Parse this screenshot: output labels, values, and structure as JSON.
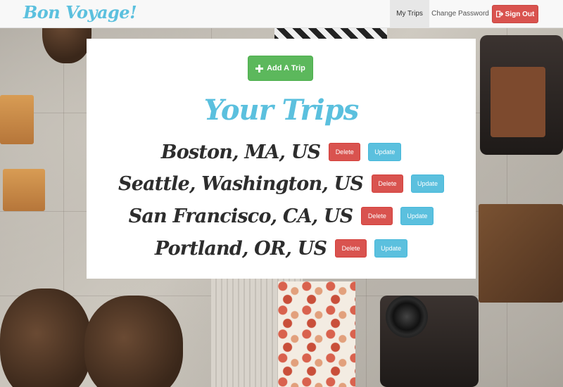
{
  "app": {
    "brand": "Bon Voyage!"
  },
  "nav": {
    "my_trips": "My Trips",
    "change_password": "Change Password",
    "sign_out": "Sign Out"
  },
  "main": {
    "add_trip": "Add A Trip",
    "title": "Your Trips",
    "trips": [
      {
        "name": "Boston, MA, US",
        "delete": "Delete",
        "update": "Update"
      },
      {
        "name": "Seattle, Washington, US",
        "delete": "Delete",
        "update": "Update"
      },
      {
        "name": "San Francisco, CA, US",
        "delete": "Delete",
        "update": "Update"
      },
      {
        "name": "Portland, OR, US",
        "delete": "Delete",
        "update": "Update"
      }
    ]
  },
  "icons": {
    "add": "plus-icon",
    "sign_out": "sign-out-icon"
  },
  "colors": {
    "brand": "#5bc0de",
    "success": "#5cb85c",
    "danger": "#d9534f",
    "info": "#5bc0de"
  }
}
